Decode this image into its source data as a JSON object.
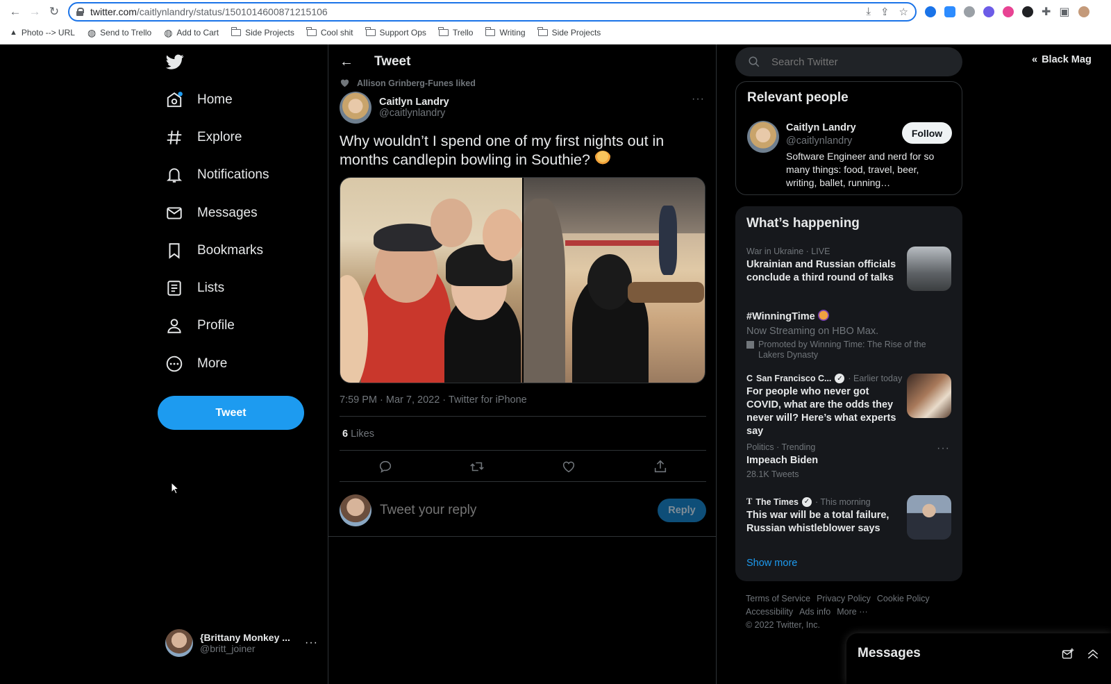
{
  "browser": {
    "url_host": "twitter.com",
    "url_path": "/caitlynlandry/status/1501014600871215106",
    "bookmarks": [
      {
        "label": "Photo --> URL",
        "icon": "triangle-icon"
      },
      {
        "label": "Send to Trello",
        "icon": "globe-icon"
      },
      {
        "label": "Add to Cart",
        "icon": "globe-icon"
      },
      {
        "label": "Side Projects",
        "icon": "folder-icon"
      },
      {
        "label": "Cool shit",
        "icon": "folder-icon"
      },
      {
        "label": "Support Ops",
        "icon": "folder-icon"
      },
      {
        "label": "Trello",
        "icon": "folder-icon"
      },
      {
        "label": "Writing",
        "icon": "folder-icon"
      },
      {
        "label": "Side Projects",
        "icon": "folder-icon"
      }
    ]
  },
  "sidebar": {
    "items": [
      {
        "label": "Home",
        "icon": "home-icon"
      },
      {
        "label": "Explore",
        "icon": "hashtag-icon"
      },
      {
        "label": "Notifications",
        "icon": "bell-icon"
      },
      {
        "label": "Messages",
        "icon": "envelope-icon"
      },
      {
        "label": "Bookmarks",
        "icon": "bookmark-icon"
      },
      {
        "label": "Lists",
        "icon": "list-icon"
      },
      {
        "label": "Profile",
        "icon": "person-icon"
      },
      {
        "label": "More",
        "icon": "more-circle-icon"
      }
    ],
    "tweet_button": "Tweet",
    "account": {
      "name": "{Brittany Monkey ...",
      "handle": "@britt_joiner"
    }
  },
  "main": {
    "header_title": "Tweet",
    "social_context": "Allison Grinberg-Funes liked",
    "author": {
      "name": "Caitlyn Landry",
      "handle": "@caitlynlandry"
    },
    "text": "Why wouldn’t I spend one of my first nights out in months candlepin bowling in Southie?",
    "timestamp": "7:59 PM · Mar 7, 2022 · Twitter for iPhone",
    "likes_count": "6",
    "likes_label": "Likes",
    "reply_placeholder": "Tweet your reply",
    "reply_button": "Reply"
  },
  "right": {
    "search_placeholder": "Search Twitter",
    "relevant": {
      "title": "Relevant people",
      "name": "Caitlyn Landry",
      "handle": "@caitlynlandry",
      "bio": "Software Engineer and nerd for so many things: food, travel, beer, writing, ballet, running…",
      "follow": "Follow"
    },
    "happening": {
      "title": "What’s happening",
      "trends": [
        {
          "context": "War in Ukraine · LIVE",
          "title": "Ukrainian and Russian officials conclude a third round of talks"
        },
        {
          "title": "#WinningTime",
          "sub": "Now Streaming on HBO Max.",
          "promo": "Promoted by Winning Time: The Rise of the Lakers Dynasty"
        },
        {
          "source": "San Francisco C...",
          "time": "· Earlier today",
          "title": "For people who never got COVID, what are the odds they never will? Here’s what experts say"
        },
        {
          "context": "Politics · Trending",
          "title": "Impeach Biden",
          "sub": "28.1K Tweets"
        },
        {
          "source": "The Times",
          "time": "· This morning",
          "title": "This war will be a total failure, Russian whistleblower says"
        }
      ],
      "show_more": "Show more"
    },
    "footer": {
      "terms": "Terms of Service",
      "privacy": "Privacy Policy",
      "cookie": "Cookie Policy",
      "accessibility": "Accessibility",
      "ads": "Ads info",
      "more": "More ···",
      "copyright": "© 2022 Twitter, Inc."
    },
    "black_mag": "Black Mag",
    "messages_drawer": "Messages"
  },
  "colors": {
    "accent": "#1d9bf0",
    "background": "#000000",
    "panel": "#16181c",
    "border": "#2f3336",
    "muted": "#71767b"
  }
}
